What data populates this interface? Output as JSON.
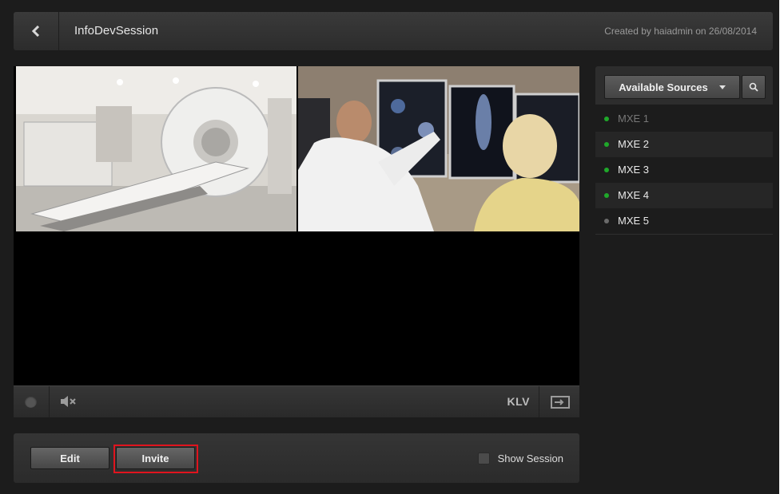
{
  "header": {
    "session_title": "InfoDevSession",
    "created_by": "Created by haiadmin on 26/08/2014"
  },
  "controls": {
    "klv_label": "KLV"
  },
  "actions": {
    "edit_label": "Edit",
    "invite_label": "Invite",
    "show_session_label": "Show Session",
    "show_session_checked": false
  },
  "sources": {
    "dropdown_label": "Available Sources",
    "items": [
      {
        "label": "MXE 1",
        "status": "online",
        "dimmed": true
      },
      {
        "label": "MXE 2",
        "status": "online",
        "dimmed": false
      },
      {
        "label": "MXE 3",
        "status": "online",
        "dimmed": false
      },
      {
        "label": "MXE 4",
        "status": "online",
        "dimmed": false
      },
      {
        "label": "MXE 5",
        "status": "offline",
        "dimmed": false
      }
    ]
  },
  "icons": {
    "back": "chevron-left-icon",
    "mute": "speaker-muted-icon",
    "output": "output-screen-icon",
    "search": "search-icon",
    "caret": "caret-down-icon"
  },
  "colors": {
    "status_online": "#1fa82a",
    "status_offline": "#6b6b6b",
    "highlight_border": "#e0141e"
  }
}
